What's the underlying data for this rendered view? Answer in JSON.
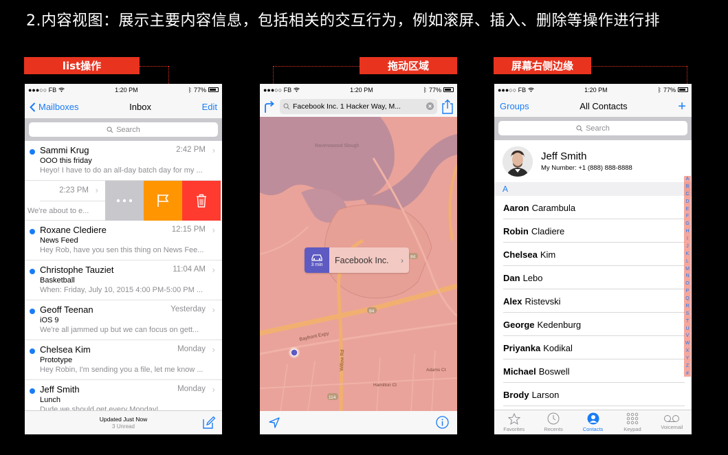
{
  "slide_title": "2.内容视图：展示主要内容信息，包括相关的交互行为，例如滚屏、插入、删除等操作进行排",
  "tags": {
    "list": "list操作",
    "drag": "拖动区域",
    "edge": "屏幕右侧边缘"
  },
  "status": {
    "carrier": "●●●○○ FB",
    "time": "1:20 PM",
    "battery": "77%"
  },
  "mail": {
    "back_label": "Mailboxes",
    "title": "Inbox",
    "edit_label": "Edit",
    "search_placeholder": "Search",
    "rows": [
      {
        "sender": "Sammi Krug",
        "time": "2:42 PM",
        "subject": "OOO this friday",
        "preview": "Heyo! I have to do an all-day batch day for my ..."
      },
      {
        "sender": "Roxane Clediere",
        "time": "12:15 PM",
        "subject": "News Feed",
        "preview": "Hey Rob, have you sen this thing on News Fee..."
      },
      {
        "sender": "Christophe Tauziet",
        "time": "11:04 AM",
        "subject": "Basketball",
        "preview": "When: Friday, July 10, 2015 4:00 PM-5:00 PM ..."
      },
      {
        "sender": "Geoff Teenan",
        "time": "Yesterday",
        "subject": "iOS 9",
        "preview": "We're all jammed up but we can focus on gett..."
      },
      {
        "sender": "Chelsea Kim",
        "time": "Monday",
        "subject": "Prototype",
        "preview": "Hey Robin, I'm sending you a file, let me know ..."
      },
      {
        "sender": "Jeff Smith",
        "time": "Monday",
        "subject": "Lunch",
        "preview": "Dude we should get every Monday!"
      }
    ],
    "swipe_row": {
      "time": "2:23 PM",
      "preview": "We're about to e..."
    },
    "updated": "Updated Just Now",
    "unread": "3 Unread"
  },
  "map": {
    "search_text": "Facebook Inc. 1 Hacker Way, M...",
    "callout_name": "Facebook Inc.",
    "callout_eta": "3 min",
    "labels": {
      "slough": "Ravenswood Slough",
      "expy": "Bayfront Expy",
      "willow": "Willow Rd",
      "hamilton": "Hamilton Ct",
      "adams": "Adams Ct",
      "shield84a": "84",
      "shield84b": "84",
      "shield114": "114"
    }
  },
  "contacts": {
    "groups_label": "Groups",
    "title": "All Contacts",
    "plus_label": "+",
    "search_placeholder": "Search",
    "me_name": "Jeff Smith",
    "me_number_label": "My Number:",
    "me_number": "+1 (888) 888-8888",
    "section": "A",
    "rows": [
      {
        "first": "Aaron",
        "last": "Carambula"
      },
      {
        "first": "Robin",
        "last": "Cladiere"
      },
      {
        "first": "Chelsea",
        "last": "Kim"
      },
      {
        "first": "Dan",
        "last": "Lebo"
      },
      {
        "first": "Alex",
        "last": "Ristevski"
      },
      {
        "first": "George",
        "last": "Kedenburg"
      },
      {
        "first": "Priyanka",
        "last": "Kodikal"
      },
      {
        "first": "Michael",
        "last": "Boswell"
      },
      {
        "first": "Brody",
        "last": "Larson"
      }
    ],
    "index_letters": [
      "A",
      "B",
      "C",
      "D",
      "E",
      "F",
      "G",
      "H",
      "I",
      "J",
      "K",
      "L",
      "M",
      "N",
      "O",
      "P",
      "Q",
      "R",
      "S",
      "T",
      "U",
      "V",
      "W",
      "X",
      "Y",
      "Z",
      "#"
    ],
    "tabs": [
      {
        "label": "Favorites",
        "icon": "star-icon"
      },
      {
        "label": "Recents",
        "icon": "clock-icon"
      },
      {
        "label": "Contacts",
        "icon": "person-icon"
      },
      {
        "label": "Keypad",
        "icon": "keypad-icon"
      },
      {
        "label": "Voicemail",
        "icon": "voicemail-icon"
      }
    ],
    "active_tab": "Contacts"
  },
  "colors": {
    "accent_red": "#e8331f",
    "ios_blue": "#1a7cf5",
    "flag_orange": "#ff9500",
    "delete_red": "#ff3b30"
  }
}
